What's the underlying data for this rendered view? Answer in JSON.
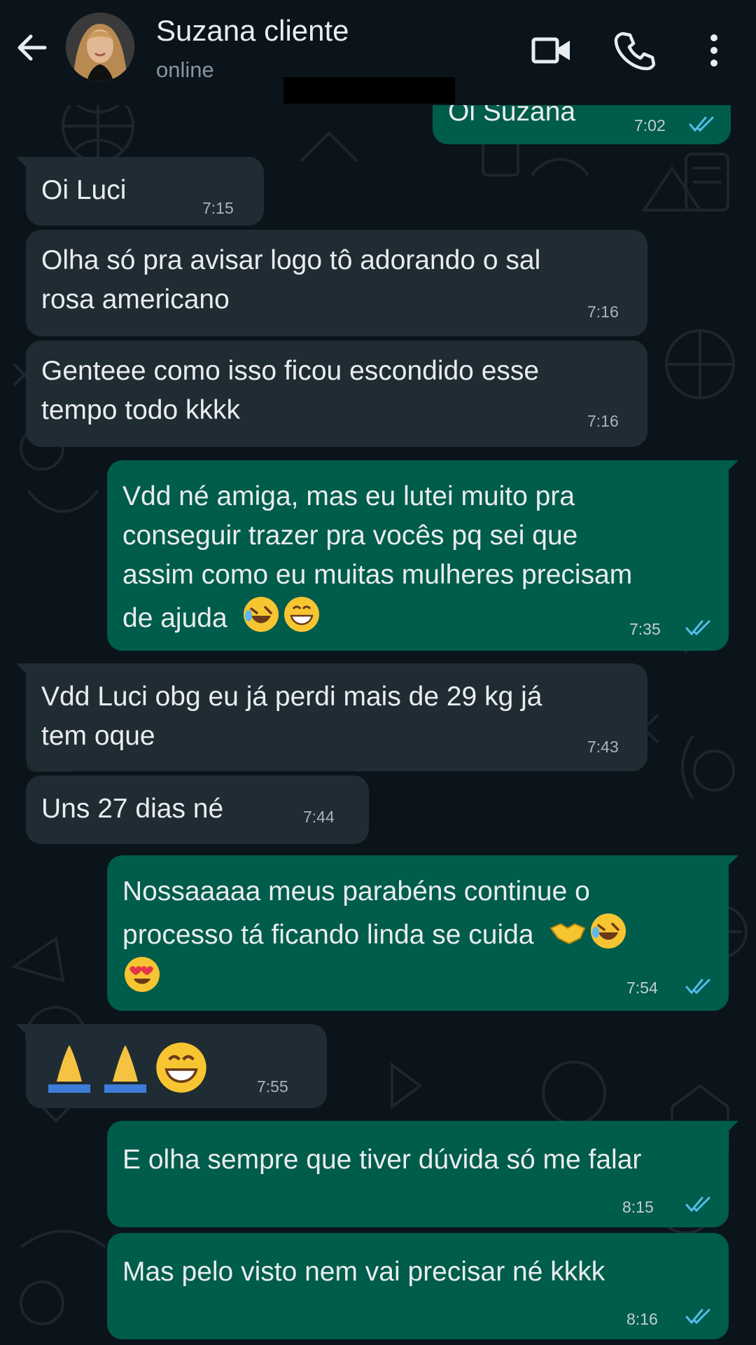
{
  "header": {
    "back_icon": "arrow-left-icon",
    "contact_name": "Suzana cliente",
    "status": "online",
    "video_icon": "video-call-icon",
    "call_icon": "phone-icon",
    "menu_icon": "more-vertical-icon"
  },
  "colors": {
    "background": "#0b141a",
    "incoming_bubble": "#202c33",
    "outgoing_bubble": "#005c4b",
    "read_ticks": "#53bdeb"
  },
  "messages": [
    {
      "direction": "out",
      "lines": [
        "Oi Suzana"
      ],
      "time": "7:02",
      "read": true
    },
    {
      "direction": "in",
      "lines": [
        "Oi Luci"
      ],
      "time": "7:15"
    },
    {
      "direction": "in",
      "lines": [
        "Olha só pra avisar logo tô adorando o sal",
        "rosa americano"
      ],
      "time": "7:16"
    },
    {
      "direction": "in",
      "lines": [
        "Genteee como isso ficou escondido esse",
        "tempo todo kkkk"
      ],
      "time": "7:16"
    },
    {
      "direction": "out",
      "lines": [
        "Vdd né amiga, mas eu lutei muito pra",
        "conseguir trazer pra vocês pq sei que",
        "assim como eu muitas mulheres precisam",
        "de ajuda"
      ],
      "emojis": [
        "rolling-laughing-emoji",
        "grinning-emoji"
      ],
      "time": "7:35",
      "read": true
    },
    {
      "direction": "in",
      "lines": [
        "Vdd Luci obg eu já perdi mais de 29 kg já",
        "tem oque"
      ],
      "time": "7:43"
    },
    {
      "direction": "in",
      "lines": [
        "Uns 27 dias né"
      ],
      "time": "7:44"
    },
    {
      "direction": "out",
      "lines": [
        "Nossaaaaa meus parabéns continue o",
        "processo tá ficando linda se cuida"
      ],
      "emojis": [
        "handshake-emoji",
        "rolling-laughing-emoji",
        "heart-eyes-emoji"
      ],
      "time": "7:54",
      "read": true
    },
    {
      "direction": "in",
      "lines": [],
      "emojis": [
        "folded-hands-emoji",
        "folded-hands-emoji",
        "grinning-emoji"
      ],
      "time": "7:55"
    },
    {
      "direction": "out",
      "lines": [
        "E olha sempre que tiver dúvida só me falar"
      ],
      "time": "8:15",
      "read": true
    },
    {
      "direction": "out",
      "lines": [
        "Mas pelo visto nem vai precisar né kkkk"
      ],
      "time": "8:16",
      "read": true
    }
  ]
}
